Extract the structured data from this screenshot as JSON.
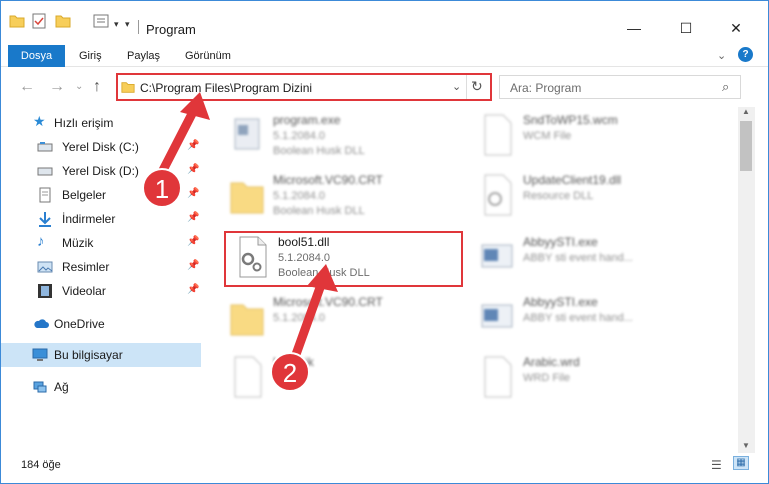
{
  "window": {
    "title": "Program"
  },
  "ribbon": {
    "tabs": [
      "Dosya",
      "Giriş",
      "Paylaş",
      "Görünüm"
    ]
  },
  "address": {
    "path": "C:\\Program Files\\Program Dizini"
  },
  "search": {
    "placeholder": "Ara: Program"
  },
  "sidebar": {
    "items": [
      {
        "label": "Hızlı erişim",
        "icon": "star-icon"
      },
      {
        "label": "Yerel Disk (C:)",
        "icon": "drive-icon"
      },
      {
        "label": "Yerel Disk (D:)",
        "icon": "drive-icon"
      },
      {
        "label": "Belgeler",
        "icon": "documents-icon"
      },
      {
        "label": "İndirmeler",
        "icon": "download-icon"
      },
      {
        "label": "Müzik",
        "icon": "music-icon"
      },
      {
        "label": "Resimler",
        "icon": "pictures-icon"
      },
      {
        "label": "Videolar",
        "icon": "video-icon"
      },
      {
        "label": "OneDrive",
        "icon": "cloud-icon"
      },
      {
        "label": "Bu bilgisayar",
        "icon": "computer-icon"
      },
      {
        "label": "Ağ",
        "icon": "network-icon"
      }
    ]
  },
  "files": [
    {
      "name": "program.exe",
      "version": "5.1.2084.0",
      "desc": "Boolean Husk DLL"
    },
    {
      "name": "SndToWP15.wcm",
      "version": "WCM File",
      "desc": ""
    },
    {
      "name": "Microsoft.VC90.CRT",
      "version": "5.1.2084.0",
      "desc": "Boolean Husk DLL"
    },
    {
      "name": "UpdateClient19.dll",
      "version": "Resource DLL",
      "desc": ""
    },
    {
      "name": "bool51.dll",
      "version": "5.1.2084.0",
      "desc": "Boolean Husk DLL"
    },
    {
      "name": "AbbyySTI.exe",
      "version": "ABBY sti event hand...",
      "desc": ""
    },
    {
      "name": "Microsoft.VC90.CRT",
      "version": "5.1.2084.0",
      "desc": ""
    },
    {
      "name": "AbbyySTI.exe",
      "version": "ABBY sti event hand...",
      "desc": ""
    },
    {
      "name": "Lion.cjk",
      "version": "",
      "desc": ""
    },
    {
      "name": "Arabic.wrd",
      "version": "WRD File",
      "desc": ""
    }
  ],
  "annotations": {
    "step1": "1",
    "step2": "2"
  },
  "status": {
    "count": "184 öğe"
  },
  "colors": {
    "accent": "#1979ca",
    "highlight": "#e0363a"
  }
}
